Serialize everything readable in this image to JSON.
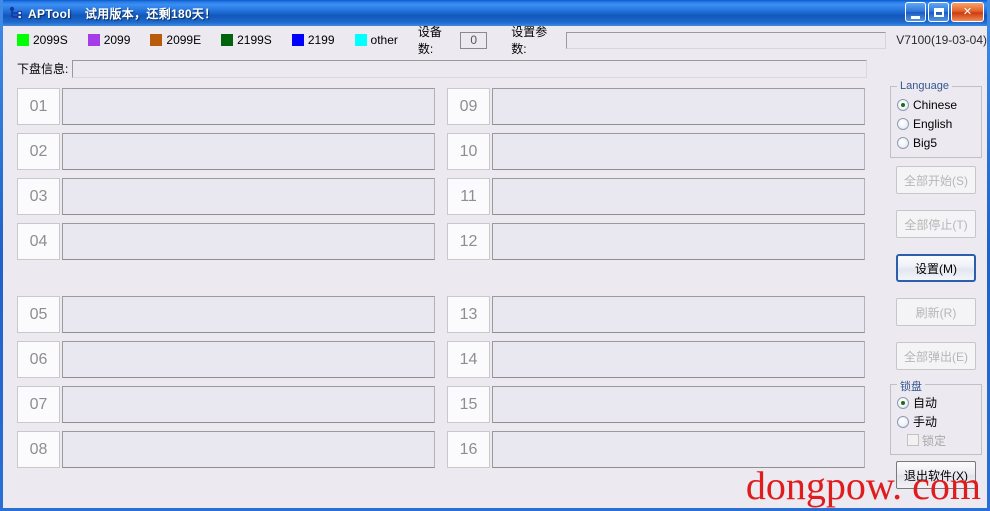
{
  "window": {
    "title": "APTool",
    "subtitle": "试用版本，还剩180天！",
    "icon": "usb-device-icon",
    "buttons": {
      "minimize": "minimize-button",
      "maximize": "maximize-button",
      "close": "close-button"
    }
  },
  "legend": [
    {
      "label": "2099S",
      "color": "#00ff00"
    },
    {
      "label": "2099",
      "color": "#a43ce8"
    },
    {
      "label": "2099E",
      "color": "#b85c0c"
    },
    {
      "label": "2199S",
      "color": "#00640c"
    },
    {
      "label": "2199",
      "color": "#0000ff"
    },
    {
      "label": "other",
      "color": "#00ffff"
    }
  ],
  "toolbar": {
    "device_count_label": "设备数:",
    "device_count_value": "0",
    "params_label": "设置参数:",
    "params_value": "",
    "params_placeholder": "",
    "version": "V7100(19-03-04)"
  },
  "disk_info": {
    "label": "下盘信息:",
    "value": "",
    "placeholder": ""
  },
  "slots": {
    "left_top": [
      "01",
      "02",
      "03",
      "04"
    ],
    "right_top": [
      "09",
      "10",
      "11",
      "12"
    ],
    "left_bottom": [
      "05",
      "06",
      "07",
      "08"
    ],
    "right_bottom": [
      "13",
      "14",
      "15",
      "16"
    ]
  },
  "language_group": {
    "title": "Language",
    "options": [
      {
        "label": "Chinese",
        "selected": true
      },
      {
        "label": "English",
        "selected": false
      },
      {
        "label": "Big5",
        "selected": false
      }
    ]
  },
  "actions": [
    {
      "label": "全部开始(S)",
      "state": "disabled"
    },
    {
      "label": "全部停止(T)",
      "state": "disabled"
    },
    {
      "label": "设置(M)",
      "state": "default"
    },
    {
      "label": "刷新(R)",
      "state": "disabled"
    },
    {
      "label": "全部弹出(E)",
      "state": "disabled"
    }
  ],
  "lock_group": {
    "title": "锁盘",
    "options": [
      {
        "label": "自动",
        "selected": true
      },
      {
        "label": "手动",
        "selected": false
      }
    ],
    "checkbox": {
      "label": "锁定",
      "checked": false,
      "state": "disabled"
    }
  },
  "exit_button": {
    "label": "退出软件(X)"
  },
  "watermark": {
    "text": "dongpow. com",
    "color": "#e01d1d"
  }
}
